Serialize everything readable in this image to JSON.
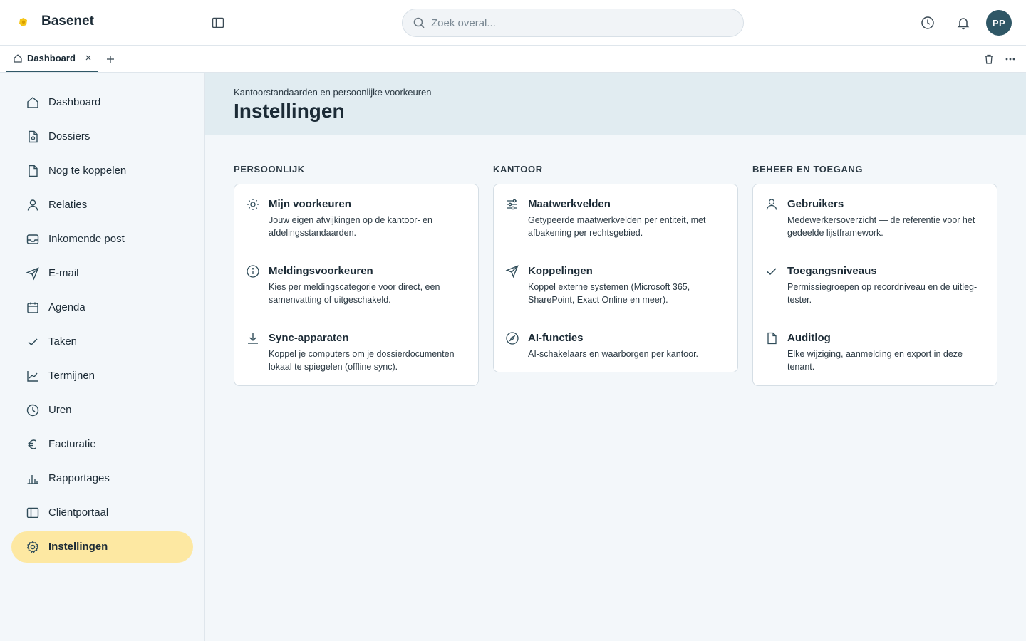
{
  "app": {
    "brand": "Basenet",
    "brand_color": "#f5c518",
    "accent_color": "#2f5766"
  },
  "search": {
    "placeholder": "Zoek overal..."
  },
  "user": {
    "initials": "PP"
  },
  "tabs": [
    {
      "label": "Dashboard",
      "icon": "home-icon"
    }
  ],
  "sidebar": {
    "items": [
      {
        "label": "Dashboard",
        "icon": "home-icon"
      },
      {
        "label": "Dossiers",
        "icon": "file-gear-icon"
      },
      {
        "label": "Nog te koppelen",
        "icon": "file-icon"
      },
      {
        "label": "Relaties",
        "icon": "user-icon"
      },
      {
        "label": "Inkomende post",
        "icon": "inbox-icon"
      },
      {
        "label": "E-mail",
        "icon": "send-icon"
      },
      {
        "label": "Agenda",
        "icon": "calendar-icon"
      },
      {
        "label": "Taken",
        "icon": "check-icon"
      },
      {
        "label": "Termijnen",
        "icon": "line-chart-icon"
      },
      {
        "label": "Uren",
        "icon": "clock-icon"
      },
      {
        "label": "Facturatie",
        "icon": "euro-icon"
      },
      {
        "label": "Rapportages",
        "icon": "bar-chart-icon"
      },
      {
        "label": "Cliëntportaal",
        "icon": "panel-icon"
      },
      {
        "label": "Instellingen",
        "icon": "gear-icon",
        "active": true
      }
    ]
  },
  "page": {
    "subtitle": "Kantoorstandaarden en persoonlijke voorkeuren",
    "title": "Instellingen"
  },
  "sections": [
    {
      "heading": "PERSOONLIJK",
      "items": [
        {
          "title": "Mijn voorkeuren",
          "desc": "Jouw eigen afwijkingen op de kantoor- en afdelingsstandaarden.",
          "icon": "sun-icon"
        },
        {
          "title": "Meldingsvoorkeuren",
          "desc": "Kies per meldingscategorie voor direct, een samenvatting of uitgeschakeld.",
          "icon": "info-icon"
        },
        {
          "title": "Sync-apparaten",
          "desc": "Koppel je computers om je dossierdocumenten lokaal te spiegelen (offline sync).",
          "icon": "download-icon"
        }
      ]
    },
    {
      "heading": "KANTOOR",
      "items": [
        {
          "title": "Maatwerkvelden",
          "desc": "Getypeerde maatwerkvelden per entiteit, met afbakening per rechtsgebied.",
          "icon": "sliders-icon"
        },
        {
          "title": "Koppelingen",
          "desc": "Koppel externe systemen (Microsoft 365, SharePoint, Exact Online en meer).",
          "icon": "send-icon"
        },
        {
          "title": "AI-functies",
          "desc": "AI-schakelaars en waarborgen per kantoor.",
          "icon": "compass-icon"
        }
      ]
    },
    {
      "heading": "BEHEER EN TOEGANG",
      "items": [
        {
          "title": "Gebruikers",
          "desc": "Medewerkersoverzicht — de referentie voor het gedeelde lijstframework.",
          "icon": "user-icon"
        },
        {
          "title": "Toegangsniveaus",
          "desc": "Permissiegroepen op recordniveau en de uitleg-tester.",
          "icon": "check-icon"
        },
        {
          "title": "Auditlog",
          "desc": "Elke wijziging, aanmelding en export in deze tenant.",
          "icon": "file-icon"
        }
      ]
    }
  ]
}
